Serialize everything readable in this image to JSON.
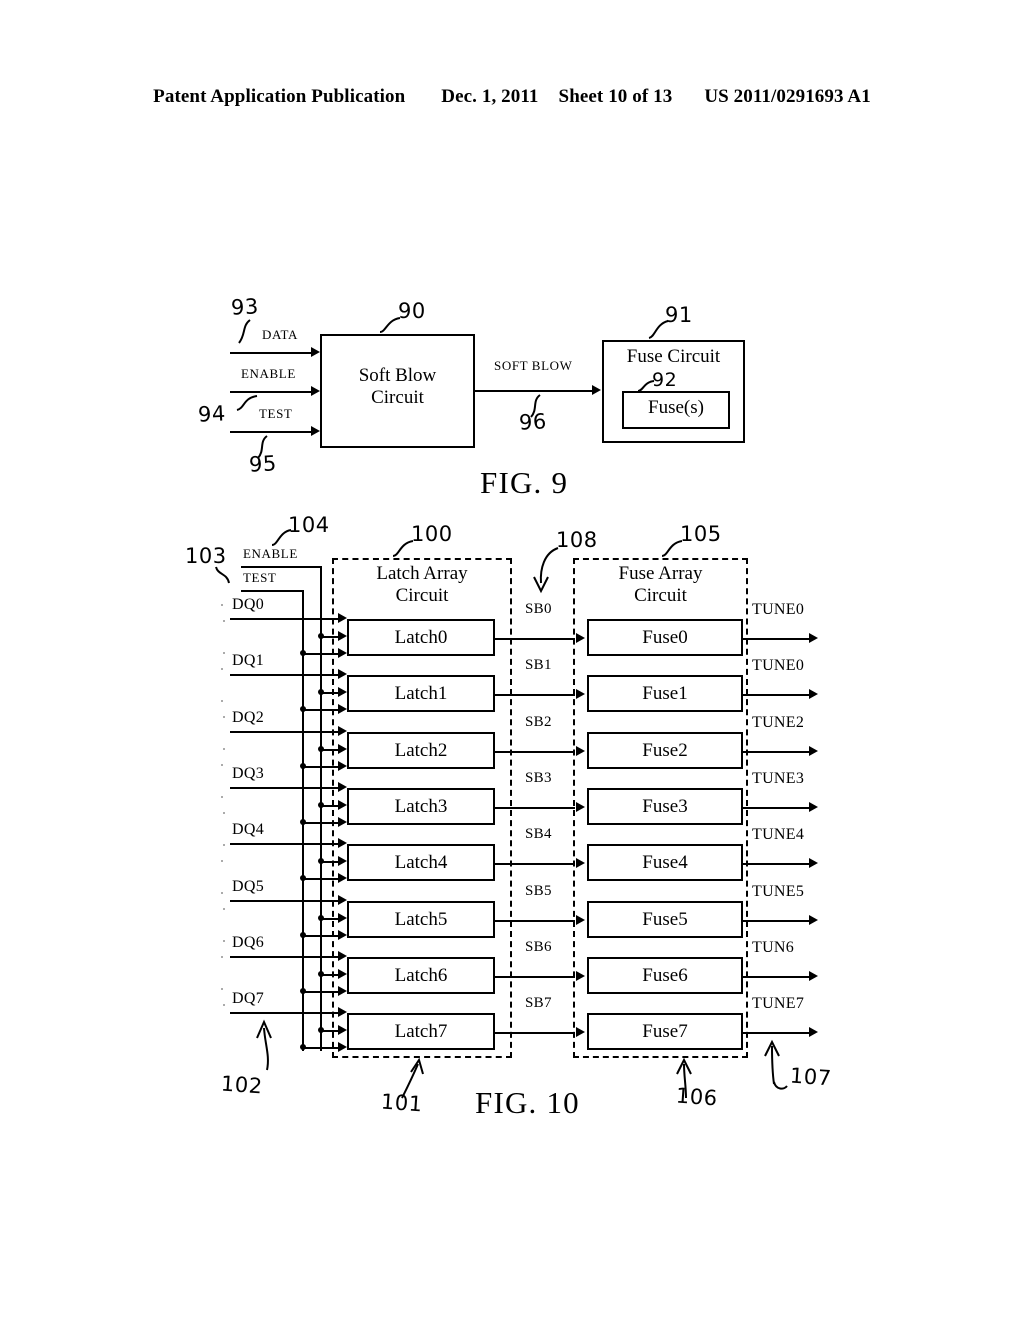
{
  "header": {
    "publication": "Patent Application Publication",
    "date": "Dec. 1, 2011",
    "sheet": "Sheet 10 of 13",
    "docket": "US 2011/0291693 A1"
  },
  "fig9": {
    "caption": "FIG. 9",
    "blocks": {
      "soft_blow": {
        "line1": "Soft Blow",
        "line2": "Circuit",
        "ref": "90"
      },
      "fuse_circuit": {
        "title": "Fuse Circuit",
        "ref": "91"
      },
      "fuses": {
        "label": "Fuse(s)",
        "ref": "92"
      }
    },
    "signals": {
      "data": {
        "label": "DATA",
        "ref": "93"
      },
      "enable": {
        "label": "ENABLE",
        "ref": "94"
      },
      "test": {
        "label": "TEST",
        "ref": "95"
      },
      "soft_blow_out": {
        "label": "SOFT BLOW",
        "ref": "96"
      }
    }
  },
  "fig10": {
    "caption": "FIG. 10",
    "latch_array": {
      "line1": "Latch Array",
      "line2": "Circuit",
      "ref": "100",
      "inner_ref": "101"
    },
    "fuse_array": {
      "line1": "Fuse Array",
      "line2": "Circuit",
      "ref": "105",
      "inner_ref": "106"
    },
    "controls": {
      "enable": {
        "label": "ENABLE",
        "ref": "104"
      },
      "test": {
        "label": "TEST",
        "ref": "103"
      }
    },
    "bus_refs": {
      "dq_bus": "102",
      "sb_bus": "108",
      "tune_bus": "107"
    },
    "rows": [
      {
        "dq": "DQ0",
        "latch": "Latch0",
        "sb": "SB0",
        "fuse": "Fuse0",
        "tune": "TUNE0"
      },
      {
        "dq": "DQ1",
        "latch": "Latch1",
        "sb": "SB1",
        "fuse": "Fuse1",
        "tune": "TUNE0"
      },
      {
        "dq": "DQ2",
        "latch": "Latch2",
        "sb": "SB2",
        "fuse": "Fuse2",
        "tune": "TUNE2"
      },
      {
        "dq": "DQ3",
        "latch": "Latch3",
        "sb": "SB3",
        "fuse": "Fuse3",
        "tune": "TUNE3"
      },
      {
        "dq": "DQ4",
        "latch": "Latch4",
        "sb": "SB4",
        "fuse": "Fuse4",
        "tune": "TUNE4"
      },
      {
        "dq": "DQ5",
        "latch": "Latch5",
        "sb": "SB5",
        "fuse": "Fuse5",
        "tune": "TUNE5"
      },
      {
        "dq": "DQ6",
        "latch": "Latch6",
        "sb": "SB6",
        "fuse": "Fuse6",
        "tune": "TUN6"
      },
      {
        "dq": "DQ7",
        "latch": "Latch7",
        "sb": "SB7",
        "fuse": "Fuse7",
        "tune": "TUNE7"
      }
    ]
  },
  "colors": {
    "ink": "#000000",
    "paper": "#ffffff"
  }
}
